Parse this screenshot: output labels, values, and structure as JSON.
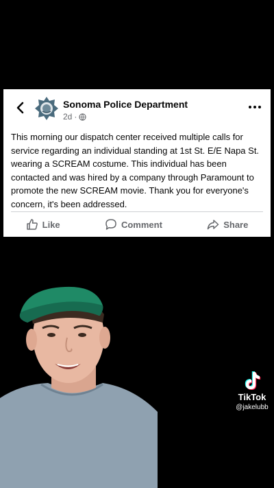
{
  "post": {
    "page_name": "Sonoma Police Department",
    "time": "2d",
    "separator": "·",
    "icons": {
      "back": "chevron-left-icon",
      "audience": "globe-icon",
      "more": "more-icon",
      "avatar": "police-badge-icon"
    },
    "text": "This morning our dispatch center received multiple calls for service regarding an individual standing at 1st St. E/E Napa St. wearing a SCREAM costume. This individual has been contacted and was hired by a company through Paramount to promote the new SCREAM movie. Thank you for everyone's concern, it's been addressed.",
    "actions": [
      {
        "label": "Like",
        "icon": "thumbs-up-icon"
      },
      {
        "label": "Comment",
        "icon": "comment-icon"
      },
      {
        "label": "Share",
        "icon": "share-icon"
      }
    ]
  },
  "watermark": {
    "app_name": "TikTok",
    "username": "@jakelubb",
    "icon": "tiktok-logo-icon"
  },
  "colors": {
    "background": "#000000",
    "card": "#ffffff",
    "text": "#050505",
    "secondary_text": "#65676b",
    "badge": "#4a6b7d",
    "cap": "#1f8a66"
  }
}
